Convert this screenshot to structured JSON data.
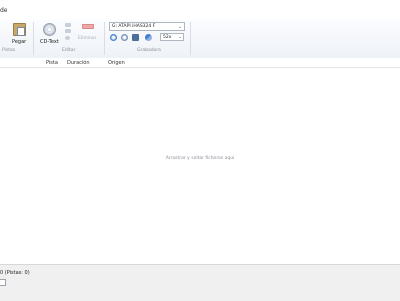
{
  "menubar": {
    "fragment": "de"
  },
  "ribbon": {
    "clipboard": {
      "paste_label": "Pegar",
      "group_label": "Pistas"
    },
    "edit": {
      "cdtext_label": "CD-Text",
      "remove_label": "Eliminar",
      "group_label": "Editar"
    },
    "burn": {
      "drive": "G: ATAPI iHAS324  F",
      "speed": "52x",
      "group_label": "Grabadora"
    }
  },
  "columns": {
    "track": "Pista",
    "duration": "Duración",
    "source": "Origen"
  },
  "track_area": {
    "drop_hint": "Arrastrar y soltar ficheros aquí"
  },
  "status": {
    "summary": "0 (Pistas: 0)"
  },
  "colors": {
    "ribbon_bg": "#eef2f7",
    "status_bg": "#f0f0f0",
    "burn_blue": "#3f7fd0"
  }
}
